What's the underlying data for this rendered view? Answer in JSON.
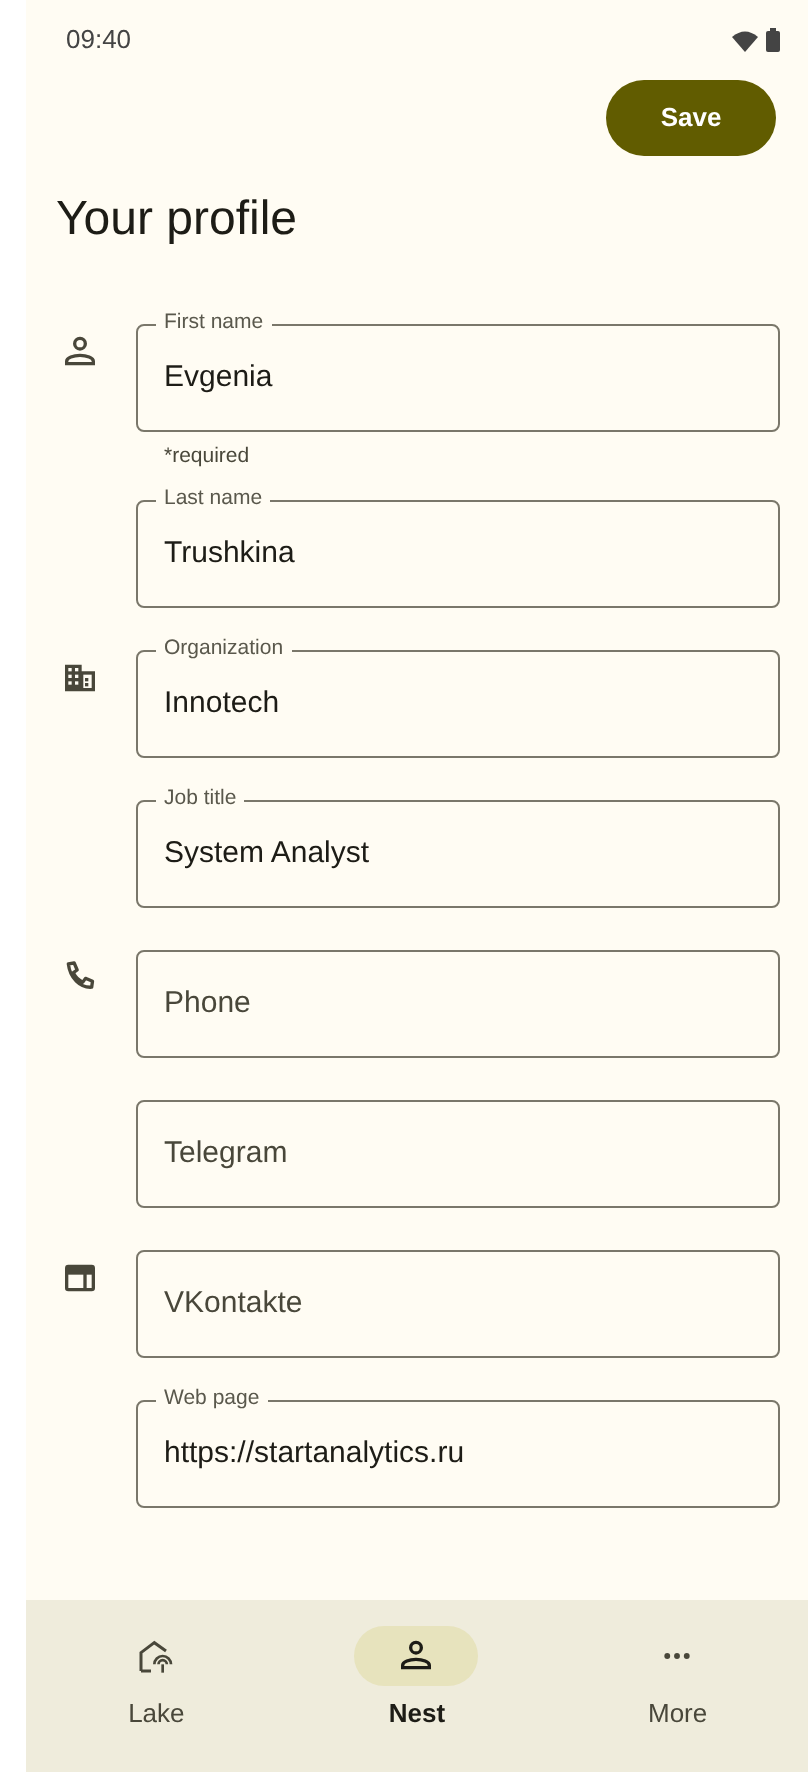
{
  "status_bar": {
    "time": "09:40"
  },
  "save_button": "Save",
  "title": "Your profile",
  "sections": [
    {
      "fields": [
        {
          "label": "First name",
          "value": "Evgenia",
          "helper": "*required"
        },
        {
          "label": "Last name",
          "value": "Trushkina"
        }
      ]
    },
    {
      "fields": [
        {
          "label": "Organization",
          "value": "Innotech"
        },
        {
          "label": "Job title",
          "value": "System Analyst"
        }
      ]
    },
    {
      "fields": [
        {
          "placeholder": "Phone"
        },
        {
          "placeholder": "Telegram"
        }
      ]
    },
    {
      "fields": [
        {
          "placeholder": "VKontakte"
        },
        {
          "label": "Web page",
          "value": "https://startanalytics.ru"
        }
      ]
    }
  ],
  "bottom_nav": [
    {
      "label": "Lake",
      "selected": false
    },
    {
      "label": "Nest",
      "selected": true
    },
    {
      "label": "More",
      "selected": false
    }
  ]
}
